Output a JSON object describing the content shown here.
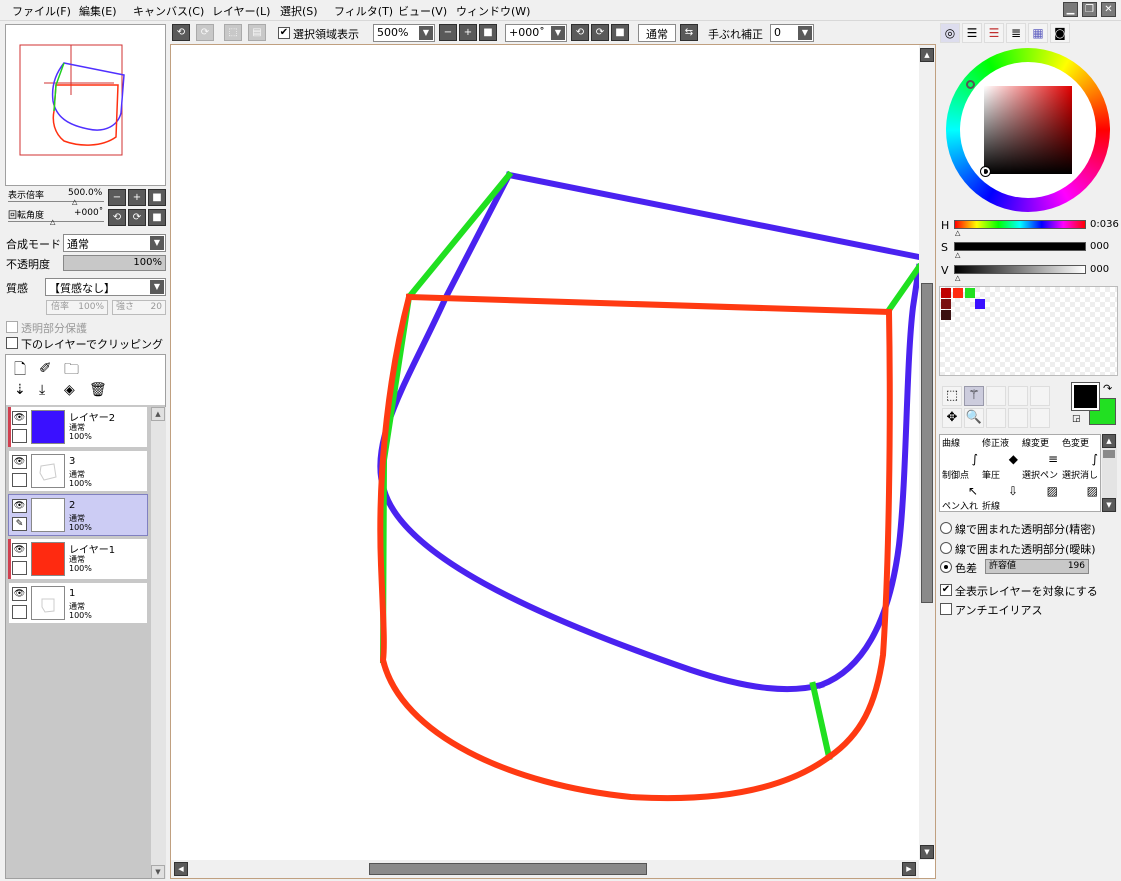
{
  "menu": [
    "ファイル(F)",
    "編集(E)",
    "キャンバス(C)",
    "レイヤー(L)",
    "選択(S)",
    "フィルタ(T)",
    "ビュー(V)",
    "ウィンドウ(W)"
  ],
  "window_buttons": {
    "minimize": "▁",
    "restore": "❐",
    "close": "✕"
  },
  "toolbar": {
    "selection_display_label": "選択領域表示",
    "selection_display_checked": "✔",
    "zoom_value": "500%",
    "rotation_value": "+000˚",
    "blend_button": "通常",
    "stabilizer_label": "手ぶれ補正",
    "stabilizer_value": "0"
  },
  "navigator": {
    "zoom_label": "表示倍率",
    "zoom_value": "500.0%",
    "rotate_label": "回転角度",
    "rotate_value": "+000˚"
  },
  "layer_props": {
    "blend_mode_label": "合成モード",
    "blend_mode_value": "通常",
    "opacity_label": "不透明度",
    "opacity_value": "100%",
    "texture_label": "質感",
    "texture_value": "【質感なし】",
    "scale_label": "倍率",
    "scale_value": "100%",
    "strength_label": "強さ",
    "strength_value": "20",
    "protect_label": "透明部分保護",
    "clip_label": "下のレイヤーでクリッピング"
  },
  "layers": [
    {
      "name": "レイヤー2",
      "mode": "通常",
      "opacity": "100%",
      "color": "#3a10ff",
      "lock": ""
    },
    {
      "name": "3",
      "mode": "通常",
      "opacity": "100%",
      "color": "",
      "lock": ""
    },
    {
      "name": "2",
      "mode": "通常",
      "opacity": "100%",
      "color": "",
      "lock": "✎"
    },
    {
      "name": "レイヤー1",
      "mode": "通常",
      "opacity": "100%",
      "color": "#ff2a10",
      "lock": ""
    },
    {
      "name": "1",
      "mode": "通常",
      "opacity": "100%",
      "color": "",
      "lock": ""
    }
  ],
  "color": {
    "h_label": "H",
    "h_value": "0:036",
    "s_label": "S",
    "s_value": "000",
    "v_label": "V",
    "v_value": "000",
    "foreground": "#000000",
    "background": "#22e022",
    "swatches": [
      {
        "color": "#c00000"
      },
      {
        "color": "#ff2a10"
      },
      {
        "color": "#22e022"
      },
      {
        "color": "#7a1010"
      },
      {
        "color": "#3a10ff"
      },
      {
        "color": "#3a1010"
      }
    ]
  },
  "tools": [
    {
      "name": "曲線",
      "icon": "∫"
    },
    {
      "name": "修正液",
      "icon": "◆"
    },
    {
      "name": "線変更",
      "icon": "≡"
    },
    {
      "name": "色変更",
      "icon": "∫"
    },
    {
      "name": "制御点",
      "icon": "↖"
    },
    {
      "name": "筆圧",
      "icon": "⇩"
    },
    {
      "name": "選択ペン",
      "icon": "▨"
    },
    {
      "name": "選択消し",
      "icon": "▨"
    },
    {
      "name": "ペン入れ",
      "icon": ""
    },
    {
      "name": "折線",
      "icon": ""
    }
  ],
  "fill_options": {
    "option1": "線で囲まれた透明部分(精密)",
    "option2": "線で囲まれた透明部分(曖昧)",
    "option3": "色差",
    "tolerance_label": "許容値",
    "tolerance_value": "196",
    "all_layers_label": "全表示レイヤーを対象にする",
    "all_layers_checked": "✔",
    "antialias_label": "アンチエイリアス"
  }
}
